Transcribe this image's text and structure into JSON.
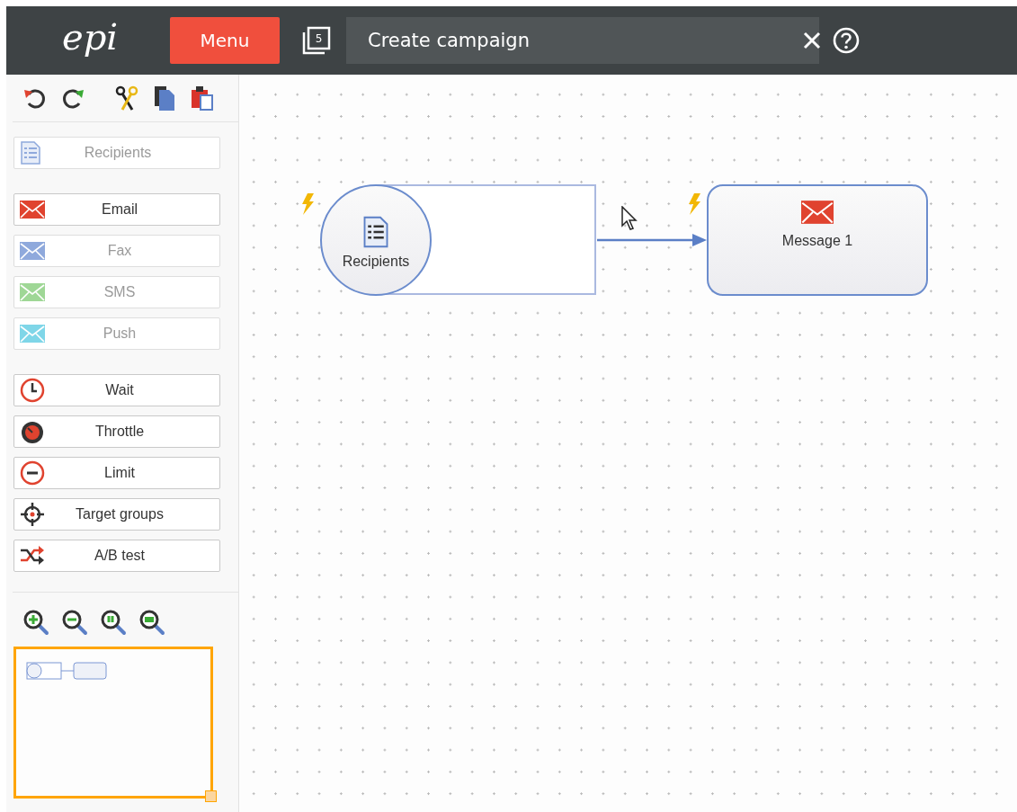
{
  "topbar": {
    "logo": "epi",
    "menu_button": "Menu",
    "window_count": "5",
    "title": "Create campaign"
  },
  "toolbar": [
    {
      "kind": "undo"
    },
    {
      "kind": "redo"
    },
    {
      "kind": "cut"
    },
    {
      "kind": "copy"
    },
    {
      "kind": "paste"
    }
  ],
  "palette": [
    {
      "items": [
        {
          "label": "Recipients",
          "kind": "list",
          "disabled": true
        }
      ]
    },
    {
      "items": [
        {
          "label": "Email",
          "kind": "envelope",
          "color": "#e0432f",
          "disabled": false
        },
        {
          "label": "Fax",
          "kind": "envelope",
          "color": "#8fa9dc",
          "disabled": true
        },
        {
          "label": "SMS",
          "kind": "envelope",
          "color": "#9fd796",
          "disabled": true
        },
        {
          "label": "Push",
          "kind": "envelope",
          "color": "#7fd6e8",
          "disabled": true
        }
      ]
    },
    {
      "items": [
        {
          "label": "Wait",
          "kind": "clock",
          "disabled": false
        },
        {
          "label": "Throttle",
          "kind": "throttle",
          "disabled": false
        },
        {
          "label": "Limit",
          "kind": "limit",
          "disabled": false
        },
        {
          "label": "Target groups",
          "kind": "target",
          "disabled": false
        },
        {
          "label": "A/B test",
          "kind": "ab",
          "disabled": false
        }
      ]
    }
  ],
  "zoom_tools": [
    {
      "kind": "zoom-in"
    },
    {
      "kind": "zoom-out"
    },
    {
      "kind": "zoom-actual"
    },
    {
      "kind": "zoom-fit"
    }
  ],
  "canvas": {
    "nodes": [
      {
        "kind": "recipients",
        "label": "Recipients",
        "selected": true
      },
      {
        "kind": "message",
        "label": "Message 1",
        "selected": false
      }
    ]
  }
}
